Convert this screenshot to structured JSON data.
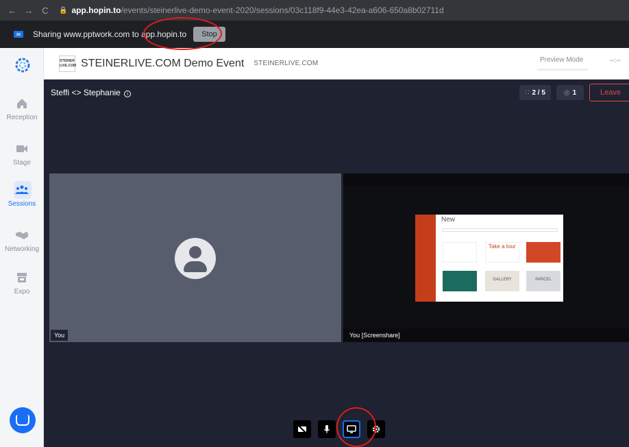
{
  "browser": {
    "url_host": "app.hopin.to",
    "url_path": "/events/steinerlive-demo-event-2020/sessions/03c118f9-44e3-42ea-a606-650a8b02711d"
  },
  "sharebar": {
    "message": "Sharing www.pptwork.com to app.hopin.to",
    "stop_label": "Stop"
  },
  "sidebar": {
    "items": [
      {
        "label": "Reception",
        "icon": "home-icon"
      },
      {
        "label": "Stage",
        "icon": "video-camera-icon"
      },
      {
        "label": "Sessions",
        "icon": "people-group-icon"
      },
      {
        "label": "Networking",
        "icon": "handshake-icon"
      },
      {
        "label": "Expo",
        "icon": "booth-icon"
      }
    ],
    "active": "Sessions",
    "accent": "#1a6ef5"
  },
  "header": {
    "logo_text": "STEINER LIVE.COM",
    "title": "STEINERLIVE.COM Demo Event",
    "subtitle": "STEINERLIVE.COM",
    "preview_mode": "Preview Mode",
    "timer": "--:--"
  },
  "session": {
    "title": "Steffi <> Stephanie",
    "participants": "2 / 5",
    "viewers": "1",
    "leave_label": "Leave",
    "tiles": [
      {
        "label": "You"
      },
      {
        "label": "You [Screenshare]"
      }
    ]
  },
  "shared_screen": {
    "heading": "New",
    "tour_text": "Take a tour",
    "gallery_text": "GALLERY",
    "parcel_text": "PARCEL"
  },
  "controls": {
    "items": [
      "camera-off-icon",
      "microphone-icon",
      "screen-share-icon",
      "settings-icon"
    ],
    "active": "screen-share-icon"
  }
}
